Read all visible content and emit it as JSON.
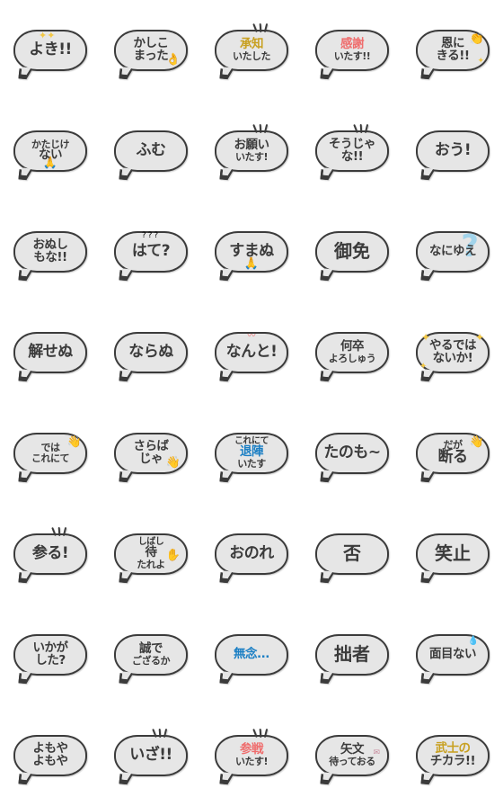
{
  "page": {
    "title": "Japanese Samurai Speech Bubble Emoji Set",
    "background_color": "#ffffff",
    "bubble_fill": "#e6e6e6",
    "bubble_stroke": "#3b3b3b",
    "accent_red": "#ef6d6d",
    "accent_blue": "#1b7fc4",
    "accent_gold": "#c8a020",
    "columns": 5,
    "rows": 8
  },
  "stickers": [
    {
      "id": 1,
      "lines": [
        "よき!!"
      ],
      "sizes": [
        "s1"
      ],
      "colors": [
        "accent-dark"
      ],
      "deco": "sparkle-top-left"
    },
    {
      "id": 2,
      "lines": [
        "かしこ",
        "まった"
      ],
      "sizes": [
        "s2",
        "s2"
      ],
      "colors": [
        "accent-dark",
        "accent-dark"
      ],
      "deco": "hand-ok"
    },
    {
      "id": 3,
      "lines": [
        "承知",
        "いたした"
      ],
      "sizes": [
        "s2",
        "s3"
      ],
      "colors": [
        "accent-gold",
        "accent-dark"
      ],
      "deco": "speedlines"
    },
    {
      "id": 4,
      "lines": [
        "感謝",
        "いたす!!"
      ],
      "sizes": [
        "s2",
        "s3"
      ],
      "colors": [
        "accent-red",
        "accent-dark"
      ],
      "deco": "none"
    },
    {
      "id": 5,
      "lines": [
        "恩に",
        "きる!!"
      ],
      "sizes": [
        "s2",
        "s2"
      ],
      "colors": [
        "accent-dark",
        "accent-dark"
      ],
      "deco": "clap-sparkle"
    },
    {
      "id": 6,
      "lines": [
        "かたじけ",
        "ない"
      ],
      "sizes": [
        "s3",
        "s2"
      ],
      "colors": [
        "accent-dark",
        "accent-dark"
      ],
      "deco": "pray"
    },
    {
      "id": 7,
      "lines": [
        "ふむ"
      ],
      "sizes": [
        "s1"
      ],
      "colors": [
        "accent-dark"
      ],
      "deco": "none"
    },
    {
      "id": 8,
      "lines": [
        "お願い",
        "いたす!"
      ],
      "sizes": [
        "s2",
        "s3"
      ],
      "colors": [
        "accent-dark",
        "accent-dark"
      ],
      "deco": "speedlines"
    },
    {
      "id": 9,
      "lines": [
        "そうじゃ",
        "な!!"
      ],
      "sizes": [
        "s2",
        "s2"
      ],
      "colors": [
        "accent-dark",
        "accent-dark"
      ],
      "deco": "speedlines"
    },
    {
      "id": 10,
      "lines": [
        "おう!"
      ],
      "sizes": [
        "s1"
      ],
      "colors": [
        "accent-dark"
      ],
      "deco": "none"
    },
    {
      "id": 11,
      "lines": [
        "おぬし",
        "もな!!"
      ],
      "sizes": [
        "s2",
        "s2"
      ],
      "colors": [
        "accent-dark",
        "accent-dark"
      ],
      "deco": "none"
    },
    {
      "id": 12,
      "lines": [
        "はて?"
      ],
      "sizes": [
        "s1"
      ],
      "colors": [
        "accent-dark"
      ],
      "deco": "question-marks"
    },
    {
      "id": 13,
      "lines": [
        "すまぬ"
      ],
      "sizes": [
        "s1"
      ],
      "colors": [
        "accent-dark"
      ],
      "deco": "pray"
    },
    {
      "id": 14,
      "lines": [
        "御免"
      ],
      "sizes": [
        "s4"
      ],
      "colors": [
        "accent-dark"
      ],
      "deco": "none"
    },
    {
      "id": 15,
      "lines": [
        "なにゆえ"
      ],
      "sizes": [
        "s2"
      ],
      "colors": [
        "accent-dark"
      ],
      "deco": "big-question"
    },
    {
      "id": 16,
      "lines": [
        "解せぬ"
      ],
      "sizes": [
        "s1"
      ],
      "colors": [
        "accent-dark"
      ],
      "deco": "none"
    },
    {
      "id": 17,
      "lines": [
        "ならぬ"
      ],
      "sizes": [
        "s1"
      ],
      "colors": [
        "accent-dark"
      ],
      "deco": "none"
    },
    {
      "id": 18,
      "lines": [
        "なんと!"
      ],
      "sizes": [
        "s1"
      ],
      "colors": [
        "accent-dark"
      ],
      "deco": "squiggle-red"
    },
    {
      "id": 19,
      "lines": [
        "何卒",
        "よろしゅう"
      ],
      "sizes": [
        "s2",
        "s3"
      ],
      "colors": [
        "accent-dark",
        "accent-dark"
      ],
      "deco": "none"
    },
    {
      "id": 20,
      "lines": [
        "やるでは",
        "ないか!"
      ],
      "sizes": [
        "s2",
        "s2"
      ],
      "colors": [
        "accent-dark",
        "accent-dark"
      ],
      "deco": "stars"
    },
    {
      "id": 21,
      "lines": [
        "では",
        "これにて"
      ],
      "sizes": [
        "s3",
        "s3"
      ],
      "colors": [
        "accent-dark",
        "accent-dark"
      ],
      "deco": "wave-hand"
    },
    {
      "id": 22,
      "lines": [
        "さらば",
        "じゃ"
      ],
      "sizes": [
        "s2",
        "s2"
      ],
      "colors": [
        "accent-dark",
        "accent-dark"
      ],
      "deco": "wave-hand-low"
    },
    {
      "id": 23,
      "lines": [
        "これにて",
        "退陣",
        "いたす"
      ],
      "sizes": [
        "s5",
        "s2",
        "s3"
      ],
      "colors": [
        "accent-dark",
        "accent-blue",
        "accent-dark"
      ],
      "deco": "none"
    },
    {
      "id": 24,
      "lines": [
        "たのも~"
      ],
      "sizes": [
        "s1"
      ],
      "colors": [
        "accent-dark"
      ],
      "deco": "none"
    },
    {
      "id": 25,
      "lines": [
        "だが",
        "断る"
      ],
      "sizes": [
        "s3",
        "s1"
      ],
      "colors": [
        "accent-dark",
        "accent-dark"
      ],
      "deco": "wave-hand"
    },
    {
      "id": 26,
      "lines": [
        "参る!"
      ],
      "sizes": [
        "s1"
      ],
      "colors": [
        "accent-dark"
      ],
      "deco": "speedlines"
    },
    {
      "id": 27,
      "lines": [
        "しばし",
        "待",
        "たれよ"
      ],
      "sizes": [
        "s5",
        "s2",
        "s3"
      ],
      "colors": [
        "accent-dark",
        "accent-dark",
        "accent-dark"
      ],
      "deco": "stop-hand"
    },
    {
      "id": 28,
      "lines": [
        "おのれ"
      ],
      "sizes": [
        "s1"
      ],
      "colors": [
        "accent-dark"
      ],
      "deco": "none"
    },
    {
      "id": 29,
      "lines": [
        "否"
      ],
      "sizes": [
        "s4"
      ],
      "colors": [
        "accent-dark"
      ],
      "deco": "none"
    },
    {
      "id": 30,
      "lines": [
        "笑止"
      ],
      "sizes": [
        "s4"
      ],
      "colors": [
        "accent-dark"
      ],
      "deco": "none"
    },
    {
      "id": 31,
      "lines": [
        "いかが",
        "した?"
      ],
      "sizes": [
        "s2",
        "s2"
      ],
      "colors": [
        "accent-dark",
        "accent-dark"
      ],
      "deco": "none"
    },
    {
      "id": 32,
      "lines": [
        "誠で",
        "ござるか"
      ],
      "sizes": [
        "s2",
        "s3"
      ],
      "colors": [
        "accent-dark",
        "accent-dark"
      ],
      "deco": "none"
    },
    {
      "id": 33,
      "lines": [
        "無念..."
      ],
      "sizes": [
        "s2"
      ],
      "colors": [
        "accent-blue"
      ],
      "deco": "none"
    },
    {
      "id": 34,
      "lines": [
        "拙者"
      ],
      "sizes": [
        "s4"
      ],
      "colors": [
        "accent-dark"
      ],
      "deco": "none"
    },
    {
      "id": 35,
      "lines": [
        "面目ない"
      ],
      "sizes": [
        "s2"
      ],
      "colors": [
        "accent-dark"
      ],
      "deco": "sweat-drop"
    },
    {
      "id": 36,
      "lines": [
        "よもや",
        "よもや"
      ],
      "sizes": [
        "s2",
        "s2"
      ],
      "colors": [
        "accent-dark",
        "accent-dark"
      ],
      "deco": "none"
    },
    {
      "id": 37,
      "lines": [
        "いざ!!"
      ],
      "sizes": [
        "s1"
      ],
      "colors": [
        "accent-dark"
      ],
      "deco": "speedlines"
    },
    {
      "id": 38,
      "lines": [
        "参戦",
        "いたす!"
      ],
      "sizes": [
        "s2",
        "s3"
      ],
      "colors": [
        "accent-red",
        "accent-dark"
      ],
      "deco": "speedlines"
    },
    {
      "id": 39,
      "lines": [
        "矢文",
        "待っておる"
      ],
      "sizes": [
        "s2",
        "s3"
      ],
      "colors": [
        "accent-dark",
        "accent-dark"
      ],
      "deco": "mail"
    },
    {
      "id": 40,
      "lines": [
        "武士の",
        "チカラ!!"
      ],
      "sizes": [
        "s2",
        "s2"
      ],
      "colors": [
        "accent-gold",
        "accent-dark"
      ],
      "deco": "none"
    }
  ]
}
